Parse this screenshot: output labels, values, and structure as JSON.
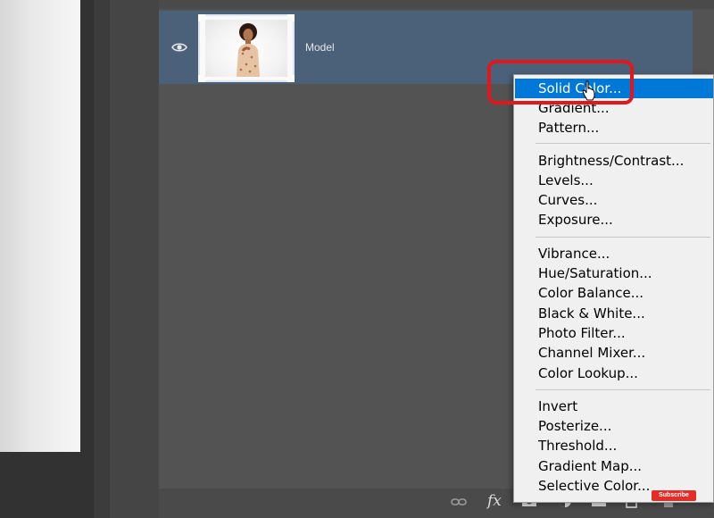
{
  "layers_panel": {
    "layer": {
      "name": "Model",
      "visibility_icon": "eye-icon",
      "thumbnail": "model-photo-thumbnail"
    }
  },
  "adjustment_menu": {
    "groups": [
      [
        "Solid Color...",
        "Gradient...",
        "Pattern..."
      ],
      [
        "Brightness/Contrast...",
        "Levels...",
        "Curves...",
        "Exposure..."
      ],
      [
        "Vibrance...",
        "Hue/Saturation...",
        "Color Balance...",
        "Black & White...",
        "Photo Filter...",
        "Channel Mixer...",
        "Color Lookup..."
      ],
      [
        "Invert",
        "Posterize...",
        "Threshold...",
        "Gradient Map...",
        "Selective Color..."
      ]
    ],
    "items": {
      "solid_color": "Solid Color...",
      "gradient": "Gradient...",
      "pattern": "Pattern...",
      "brightness_contrast": "Brightness/Contrast...",
      "levels": "Levels...",
      "curves": "Curves...",
      "exposure": "Exposure...",
      "vibrance": "Vibrance...",
      "hue_saturation": "Hue/Saturation...",
      "color_balance": "Color Balance...",
      "black_white": "Black & White...",
      "photo_filter": "Photo Filter...",
      "channel_mixer": "Channel Mixer...",
      "color_lookup": "Color Lookup...",
      "invert": "Invert",
      "posterize": "Posterize...",
      "threshold": "Threshold...",
      "gradient_map": "Gradient Map...",
      "selective_color": "Selective Color..."
    },
    "selected_item": "Solid Color...",
    "highlight_color": "#e0181b",
    "selection_color": "#0078d7"
  },
  "bottom_toolbar": {
    "icons": [
      "link-layers-icon",
      "fx-icon",
      "add-mask-icon",
      "adjustment-layer-icon",
      "group-icon",
      "new-layer-icon",
      "trash-icon"
    ],
    "fx_label": "fx"
  },
  "watermark": {
    "subscribe_label": "Subscribe"
  }
}
